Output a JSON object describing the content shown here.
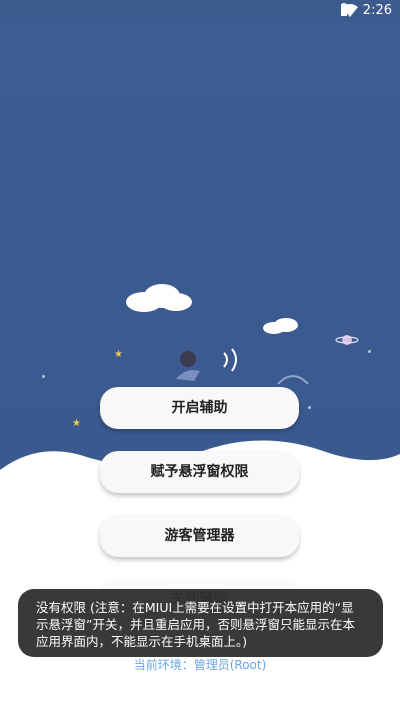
{
  "status_bar": {
    "time": "2:26"
  },
  "buttons": {
    "start_assist": "开启辅助",
    "grant_overlay": "赋予悬浮窗权限",
    "guest_manager": "游客管理器",
    "hidden_label": "关闭辅助"
  },
  "env": {
    "label": "当前环境：管理员(Root)"
  },
  "toast": {
    "message": "没有权限 (注意：在MIUI上需要在设置中打开本应用的“显示悬浮窗”开关，并且重启应用，否则悬浮窗只能显示在本应用界面内，不能显示在手机桌面上。)"
  },
  "colors": {
    "sky": "#3b5a90",
    "accent_text": "#6aa6e6",
    "toast_bg": "#282828"
  }
}
